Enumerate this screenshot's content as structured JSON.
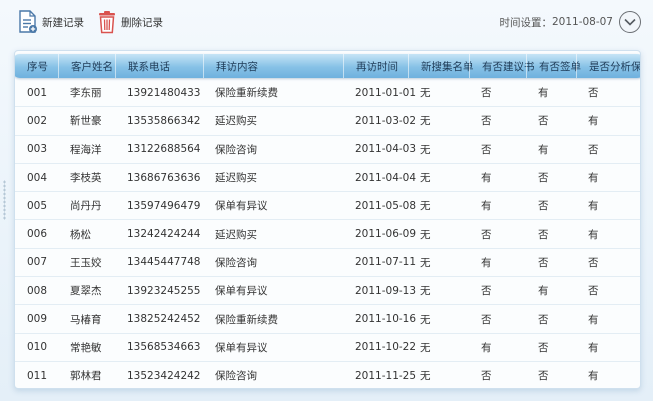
{
  "toolbar": {
    "new_label": "新建记录",
    "delete_label": "删除记录",
    "date_label": "时间设置：",
    "date_value": "2011-08-07"
  },
  "colors": {
    "header_gradient_top": "#c6e4f6",
    "header_gradient_bottom": "#6fb1de",
    "delete_icon": "#d9534f",
    "new_icon": "#4a78a8"
  },
  "icons": [
    "new-record-icon",
    "trash-icon",
    "chevron-down-icon"
  ],
  "table": {
    "headers": [
      "序号",
      "客户姓名",
      "联系电话",
      "拜访内容",
      "再访时间",
      "新搜集名单",
      "有否建议书",
      "有否签单",
      "是否分析保"
    ],
    "rows": [
      [
        "001",
        "李东丽",
        "13921480433",
        "保险重新续费",
        "2011-01-01",
        "无",
        "否",
        "有",
        "否"
      ],
      [
        "002",
        "靳世豪",
        "13535866342",
        "延迟购买",
        "2011-03-02",
        "无",
        "否",
        "否",
        "有"
      ],
      [
        "003",
        "程海洋",
        "13122688564",
        "保险咨询",
        "2011-04-03",
        "无",
        "否",
        "有",
        "否"
      ],
      [
        "004",
        "李枝英",
        "13686763636",
        "延迟购买",
        "2011-04-04",
        "无",
        "有",
        "否",
        "有"
      ],
      [
        "005",
        "尚丹丹",
        "13597496479",
        "保单有异议",
        "2011-05-08",
        "无",
        "有",
        "否",
        "有"
      ],
      [
        "006",
        "杨松",
        "13242424244",
        "延迟购买",
        "2011-06-09",
        "无",
        "否",
        "否",
        "有"
      ],
      [
        "007",
        "王玉姣",
        "13445447748",
        "保险咨询",
        "2011-07-11",
        "无",
        "有",
        "否",
        "否"
      ],
      [
        "008",
        "夏翠杰",
        "13923245255",
        "保单有异议",
        "2011-09-13",
        "无",
        "否",
        "有",
        "否"
      ],
      [
        "009",
        "马椿育",
        "13825242452",
        "保险重新续费",
        "2011-10-16",
        "无",
        "否",
        "否",
        "有"
      ],
      [
        "010",
        "常艳敏",
        "13568534663",
        "保单有异议",
        "2011-10-22",
        "无",
        "有",
        "否",
        "有"
      ],
      [
        "011",
        "郭林君",
        "13523424242",
        "保险咨询",
        "2011-11-25",
        "无",
        "否",
        "否",
        "有"
      ]
    ]
  }
}
